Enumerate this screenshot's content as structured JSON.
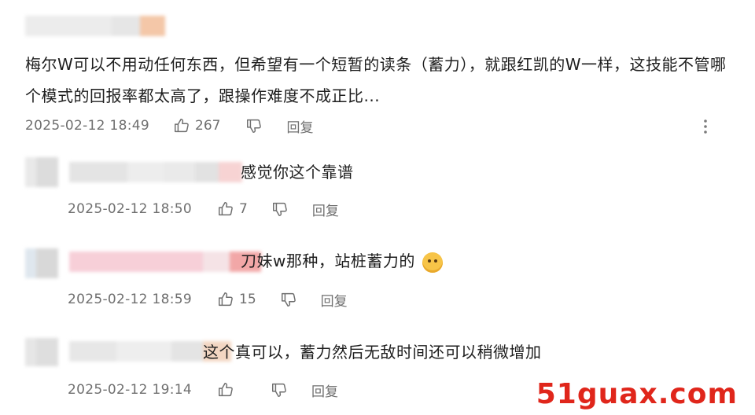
{
  "main_comment": {
    "text": "梅尔W可以不用动任何东西，但希望有一个短暂的读条（蓄力），就跟红凯的W一样，这技能不管哪个模式的回报率都太高了，跟操作难度不成正比...",
    "timestamp": "2025-02-12 18:49",
    "likes": "267",
    "reply_label": "回复"
  },
  "replies": [
    {
      "text": "感觉你这个靠谱",
      "timestamp": "2025-02-12 18:50",
      "likes": "7",
      "reply_label": "回复"
    },
    {
      "text": "刀妹w那种，站桩蓄力的",
      "timestamp": "2025-02-12 18:59",
      "likes": "15",
      "reply_label": "回复",
      "emoji": "dog-face-emoji"
    },
    {
      "text": "这个真可以，蓄力然后无敌时间还可以稍微增加",
      "timestamp": "2025-02-12 19:14",
      "likes": "",
      "reply_label": "回复"
    }
  ],
  "watermark": "51guax.com",
  "colors": {
    "watermark": "#e0261b",
    "meta_text": "#6f6f6f",
    "body_text": "#1e1e1e"
  },
  "icons": [
    "thumbs-up-icon",
    "thumbs-down-icon",
    "more-vertical-icon"
  ]
}
